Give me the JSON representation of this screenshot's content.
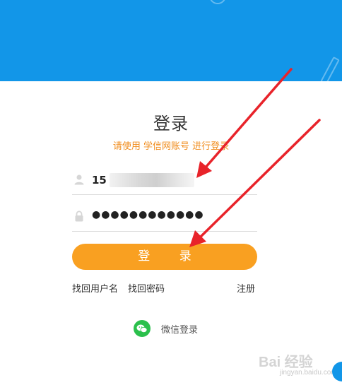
{
  "form": {
    "title": "登录",
    "subtitle": "请使用 学信网账号 进行登录",
    "username_value": "15",
    "password_dots": "●●●●●●●●●●●●",
    "login_button": "登 录"
  },
  "links": {
    "find_username": "找回用户名",
    "find_password": "找回密码",
    "register": "注册"
  },
  "social": {
    "wechat_label": "微信登录"
  },
  "watermark": {
    "brand": "Bai 经验",
    "url": "jingyan.baidu.com"
  },
  "colors": {
    "banner": "#1296e8",
    "accent_orange": "#f9a021",
    "subtitle_orange": "#f08c1c",
    "wechat_green": "#2bc04c",
    "arrow_red": "#e8232a"
  },
  "icons": {
    "username": "user-icon",
    "password": "lock-icon",
    "wechat": "wechat-icon"
  }
}
